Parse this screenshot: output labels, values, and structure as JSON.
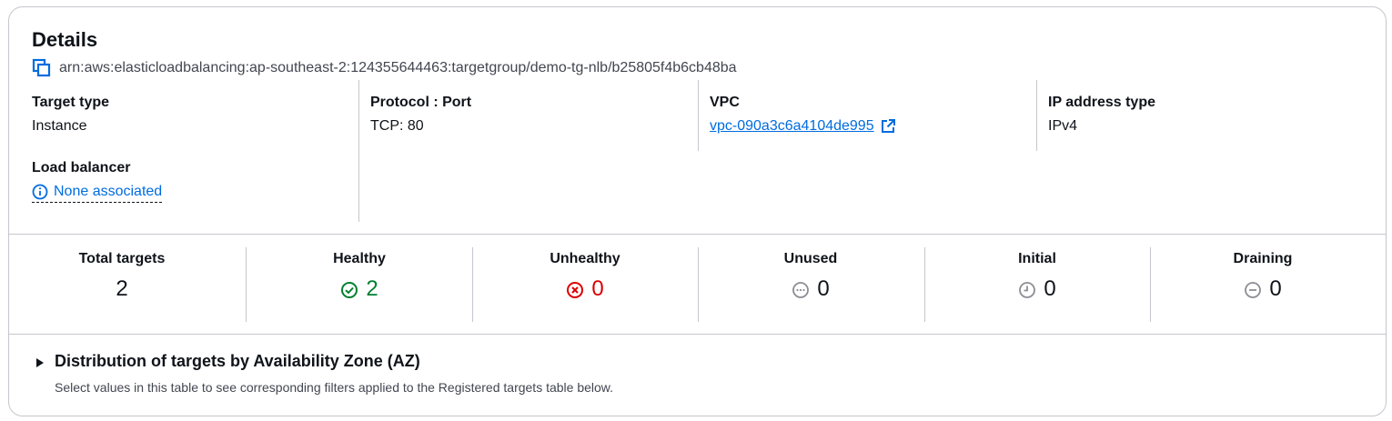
{
  "details": {
    "title": "Details",
    "arn": "arn:aws:elasticloadbalancing:ap-southeast-2:124355644463:targetgroup/demo-tg-nlb/b25805f4b6cb48ba",
    "fields": {
      "target_type": {
        "label": "Target type",
        "value": "Instance"
      },
      "protocol_port": {
        "label": "Protocol : Port",
        "value": "TCP: 80"
      },
      "vpc": {
        "label": "VPC",
        "value": "vpc-090a3c6a4104de995"
      },
      "ip_address_type": {
        "label": "IP address type",
        "value": "IPv4"
      },
      "load_balancer": {
        "label": "Load balancer",
        "value": "None associated"
      }
    }
  },
  "stats": {
    "total": {
      "label": "Total targets",
      "value": "2"
    },
    "healthy": {
      "label": "Healthy",
      "value": "2"
    },
    "unhealthy": {
      "label": "Unhealthy",
      "value": "0"
    },
    "unused": {
      "label": "Unused",
      "value": "0"
    },
    "initial": {
      "label": "Initial",
      "value": "0"
    },
    "draining": {
      "label": "Draining",
      "value": "0"
    }
  },
  "distribution": {
    "title": "Distribution of targets by Availability Zone (AZ)",
    "description": "Select values in this table to see corresponding filters applied to the Registered targets table below."
  },
  "colors": {
    "link": "#006ce0",
    "healthy": "#00802f",
    "unhealthy": "#db0000",
    "neutral": "#8c8c94",
    "border": "#c6c6cd"
  }
}
